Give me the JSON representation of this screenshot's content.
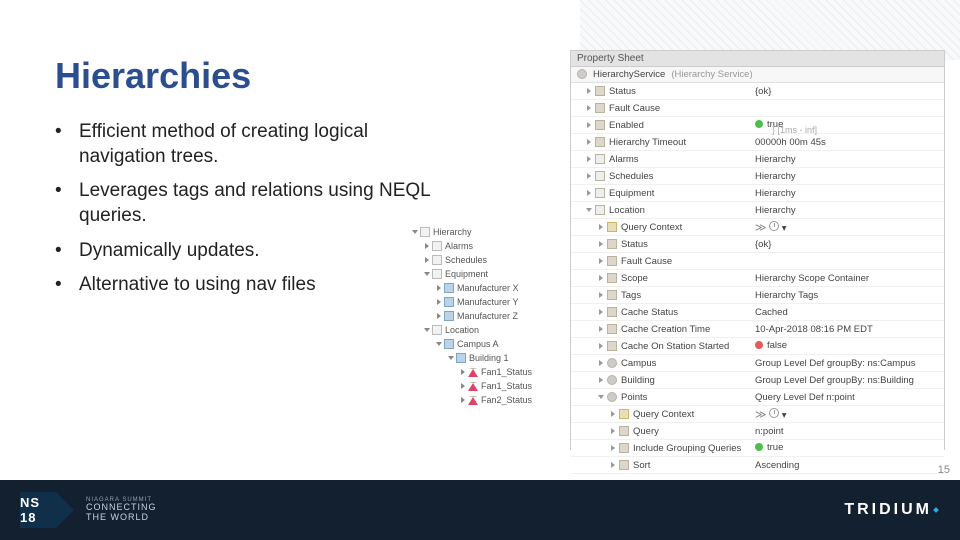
{
  "title": "Hierarchies",
  "bullets": [
    "Efficient method of creating logical navigation trees.",
    "Leverages tags and relations using NEQL queries.",
    "Dynamically updates.",
    "Alternative to using nav files"
  ],
  "navtree": [
    {
      "indent": 0,
      "open": true,
      "icon": "page",
      "label": "Hierarchy"
    },
    {
      "indent": 1,
      "open": false,
      "icon": "page",
      "label": "Alarms"
    },
    {
      "indent": 1,
      "open": false,
      "icon": "page",
      "label": "Schedules"
    },
    {
      "indent": 1,
      "open": true,
      "icon": "page",
      "label": "Equipment"
    },
    {
      "indent": 2,
      "open": false,
      "icon": "blue",
      "label": "Manufacturer X"
    },
    {
      "indent": 2,
      "open": false,
      "icon": "blue",
      "label": "Manufacturer Y"
    },
    {
      "indent": 2,
      "open": false,
      "icon": "blue",
      "label": "Manufacturer Z"
    },
    {
      "indent": 1,
      "open": true,
      "icon": "page",
      "label": "Location"
    },
    {
      "indent": 2,
      "open": true,
      "icon": "blue",
      "label": "Campus A"
    },
    {
      "indent": 3,
      "open": true,
      "icon": "blue",
      "label": "Building 1"
    },
    {
      "indent": 4,
      "open": false,
      "icon": "red",
      "label": "Fan1_Status"
    },
    {
      "indent": 4,
      "open": false,
      "icon": "red",
      "label": "Fan1_Status"
    },
    {
      "indent": 4,
      "open": false,
      "icon": "red",
      "label": "Fan2_Status"
    }
  ],
  "propertySheet": {
    "title": "Property Sheet",
    "rootName": "HierarchyService",
    "rootType": "(Hierarchy Service)",
    "rows": [
      {
        "indent": 1,
        "chev": "right",
        "icon": "pic",
        "name": "Status",
        "value": "{ok}"
      },
      {
        "indent": 1,
        "chev": "right",
        "icon": "pic",
        "name": "Fault Cause",
        "value": ""
      },
      {
        "indent": 1,
        "chev": "right",
        "icon": "pic",
        "name": "Enabled",
        "value": "● true",
        "pill": "green"
      },
      {
        "indent": 1,
        "chev": "right",
        "icon": "pic",
        "name": "Hierarchy Timeout",
        "value": "00000h 00m 45s"
      },
      {
        "indent": 1,
        "chev": "right",
        "icon": "list",
        "name": "Alarms",
        "value": "Hierarchy"
      },
      {
        "indent": 1,
        "chev": "right",
        "icon": "list",
        "name": "Schedules",
        "value": "Hierarchy"
      },
      {
        "indent": 1,
        "chev": "right",
        "icon": "list",
        "name": "Equipment",
        "value": "Hierarchy"
      },
      {
        "indent": 1,
        "chev": "down",
        "icon": "list",
        "name": "Location",
        "value": "Hierarchy"
      },
      {
        "indent": 2,
        "chev": "right",
        "icon": "folder",
        "name": "Query Context",
        "value": "≫  🕘  ▾",
        "special": "ctx"
      },
      {
        "indent": 2,
        "chev": "right",
        "icon": "pic",
        "name": "Status",
        "value": "{ok}"
      },
      {
        "indent": 2,
        "chev": "right",
        "icon": "pic",
        "name": "Fault Cause",
        "value": ""
      },
      {
        "indent": 2,
        "chev": "right",
        "icon": "pic",
        "name": "Scope",
        "value": "Hierarchy Scope Container"
      },
      {
        "indent": 2,
        "chev": "right",
        "icon": "pic",
        "name": "Tags",
        "value": "Hierarchy Tags"
      },
      {
        "indent": 2,
        "chev": "right",
        "icon": "pic",
        "name": "Cache Status",
        "value": "Cached"
      },
      {
        "indent": 2,
        "chev": "right",
        "icon": "pic",
        "name": "Cache Creation Time",
        "value": "10-Apr-2018 08:16 PM EDT"
      },
      {
        "indent": 2,
        "chev": "right",
        "icon": "pic",
        "name": "Cache On Station Started",
        "value": "● false",
        "pill": "red"
      },
      {
        "indent": 2,
        "chev": "right",
        "icon": "gear",
        "name": "Campus",
        "value": "Group Level Def groupBy: ns:Campus"
      },
      {
        "indent": 2,
        "chev": "right",
        "icon": "gear",
        "name": "Building",
        "value": "Group Level Def groupBy: ns:Building"
      },
      {
        "indent": 2,
        "chev": "down",
        "icon": "gear",
        "name": "Points",
        "value": "Query Level Def n:point"
      },
      {
        "indent": 3,
        "chev": "right",
        "icon": "folder",
        "name": "Query Context",
        "value": "≫  🕘  ▾",
        "special": "ctx"
      },
      {
        "indent": 3,
        "chev": "right",
        "icon": "pic",
        "name": "Query",
        "value": "n:point"
      },
      {
        "indent": 3,
        "chev": "right",
        "icon": "pic",
        "name": "Include Grouping Queries",
        "value": "● true",
        "pill": "green"
      },
      {
        "indent": 3,
        "chev": "right",
        "icon": "pic",
        "name": "Sort",
        "value": "Ascending"
      }
    ]
  },
  "extLabel": "} [1ms - inf]",
  "footer": {
    "badge": "NS 18",
    "tagTiny": "NIAGARA SUMMIT",
    "tag1": "CONNECTING",
    "tag2": "THE WORLD",
    "brand": "TRIDIUM"
  },
  "pageNumber": "15"
}
